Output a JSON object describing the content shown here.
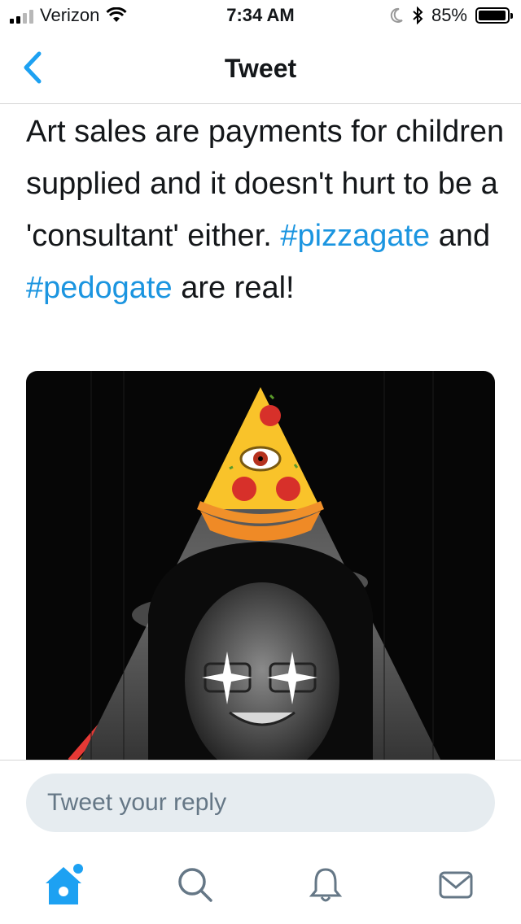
{
  "status_bar": {
    "carrier": "Verizon",
    "time": "7:34 AM",
    "battery": "85%",
    "icons": [
      "signal-icon",
      "wifi-icon",
      "moon-icon",
      "bluetooth-icon",
      "battery-icon"
    ]
  },
  "nav": {
    "title": "Tweet",
    "back_icon": "chevron-left-icon"
  },
  "tweet": {
    "text_parts": {
      "p1": "Art sales are payments for children supplied and it doesn't hurt to be a 'consultant' either. ",
      "hashtag1": "#pizzagate",
      "p2": " and ",
      "hashtag2": "#pedogate",
      "p3": " are real!"
    }
  },
  "reply": {
    "placeholder": "Tweet your reply"
  },
  "tabs": [
    {
      "icon": "home-icon",
      "active": true
    },
    {
      "icon": "search-icon",
      "active": false
    },
    {
      "icon": "bell-icon",
      "active": false
    },
    {
      "icon": "mail-icon",
      "active": false
    }
  ],
  "colors": {
    "accent": "#1da1f2",
    "hashtag": "#1b95e0",
    "text": "#14171a",
    "input_bg": "#e6ecf0",
    "placeholder": "#657786",
    "icon_gray": "#657786"
  }
}
